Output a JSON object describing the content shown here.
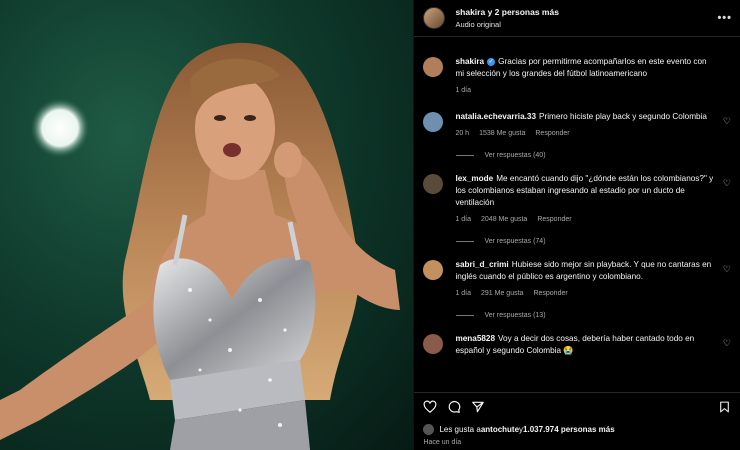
{
  "header": {
    "title": "shakira y 2 personas más",
    "subtitle": "Audio original",
    "more_icon": "more-horizontal-icon"
  },
  "comments": [
    {
      "user": "shakira",
      "verified": true,
      "text": "Gracias por permitirme acompañarlos en este evento con mi selección y los grandes del fútbol latinoamericano",
      "time": "1 día",
      "likes": "",
      "reply": "",
      "replies": "",
      "avatar_color": "#b07e5a"
    },
    {
      "user": "natalia.echevarria.33",
      "text": "Primero hiciste play back y segundo Colombia",
      "time": "20 h",
      "likes": "1538 Me gusta",
      "reply": "Responder",
      "replies": "Ver respuestas (40)",
      "avatar_color": "#6f8fb0"
    },
    {
      "user": "lex_mode",
      "text": "Me encantó cuando dijo \"¿dónde están los colombianos?\" y los colombianos estaban ingresando al estadio por un ducto de ventilación",
      "time": "1 día",
      "likes": "2048 Me gusta",
      "reply": "Responder",
      "replies": "Ver respuestas (74)",
      "avatar_color": "#5a4a3a"
    },
    {
      "user": "sabri_d_crimi",
      "text": "Hubiese sido mejor sin playback. Y que no cantaras en inglés cuando el público es argentino y colombiano.",
      "time": "1 día",
      "likes": "291 Me gusta",
      "reply": "Responder",
      "replies": "Ver respuestas (13)",
      "avatar_color": "#c4915e"
    },
    {
      "user": "mena5828",
      "text": "Voy a decir dos cosas, debería haber cantado todo en español y segundo Colombia 😭",
      "time": "",
      "likes": "",
      "reply": "",
      "replies": "",
      "avatar_color": "#8a5a4a"
    }
  ],
  "actions": {
    "like_icon": "heart-icon",
    "comment_icon": "comment-icon",
    "share_icon": "send-icon",
    "save_icon": "bookmark-icon"
  },
  "likes_line": {
    "prefix": "Les gusta a ",
    "user": "antochute",
    "middle": " y ",
    "count": "1.037.974 personas más"
  },
  "posted": "Hace un día"
}
